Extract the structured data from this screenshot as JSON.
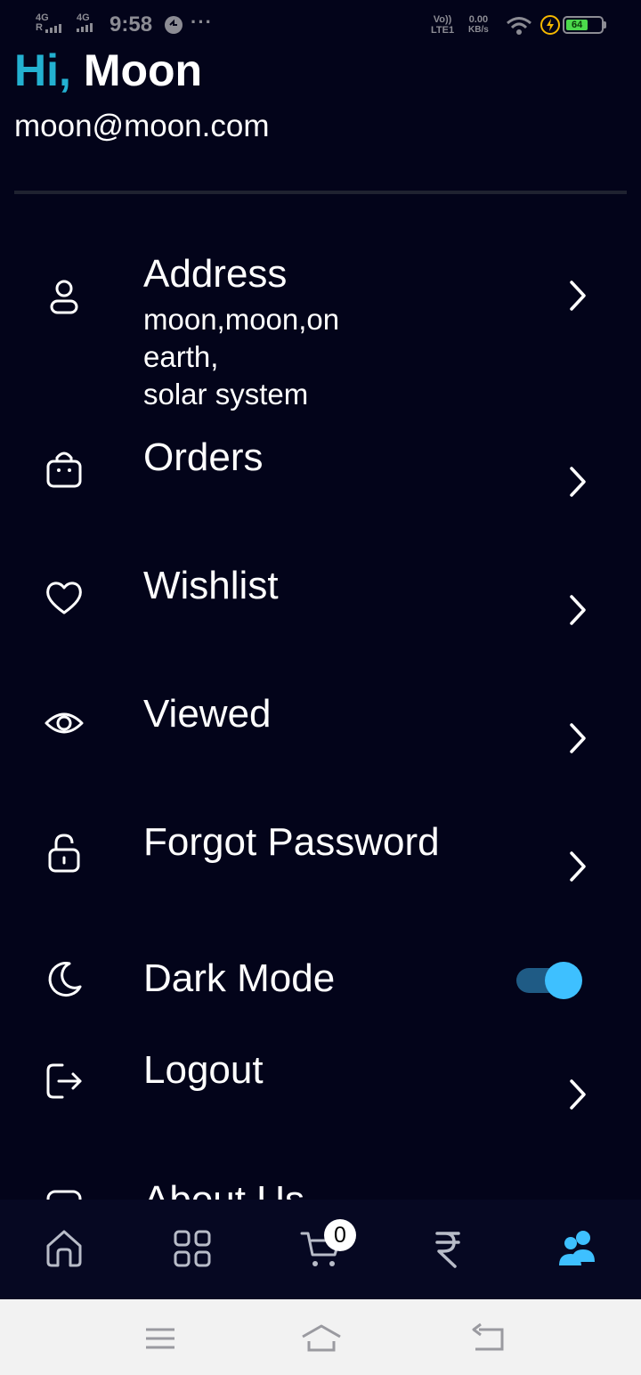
{
  "status_bar": {
    "network_1": "4G",
    "network_1_sub": "R",
    "network_2": "4G",
    "time": "9:58",
    "more": "···",
    "volte_top": "Vo))",
    "volte_bottom": "LTE1",
    "speed_value": "0.00",
    "speed_unit": "KB/s",
    "battery_level": "64",
    "battery_color": "#4cd94c",
    "charge_color": "#f5b800"
  },
  "header": {
    "greeting_prefix": "Hi,",
    "user_name": "Moon",
    "email": "moon@moon.com",
    "accent_color": "#23b1d1"
  },
  "menu": {
    "address": {
      "icon": "user-icon",
      "title": "Address",
      "subtitle": "moon,moon,on\nearth,\nsolar system"
    },
    "orders": {
      "icon": "shopping-bag-icon",
      "title": "Orders"
    },
    "wishlist": {
      "icon": "heart-icon",
      "title": "Wishlist"
    },
    "viewed": {
      "icon": "eye-icon",
      "title": "Viewed"
    },
    "forgot_password": {
      "icon": "unlock-icon",
      "title": "Forgot Password"
    },
    "dark_mode": {
      "icon": "moon-icon",
      "title": "Dark Mode",
      "enabled": true
    },
    "logout": {
      "icon": "logout-icon",
      "title": "Logout"
    },
    "about_us": {
      "icon": "info-icon",
      "title": "About Us"
    }
  },
  "bottom_nav": {
    "items": [
      {
        "name": "home",
        "icon": "home-icon",
        "active": false
      },
      {
        "name": "categories",
        "icon": "grid-icon",
        "active": false
      },
      {
        "name": "cart",
        "icon": "cart-icon",
        "active": false,
        "badge": "0"
      },
      {
        "name": "payments",
        "icon": "rupee-icon",
        "active": false
      },
      {
        "name": "account",
        "icon": "users-icon",
        "active": true
      }
    ],
    "active_color": "#3ec0ff"
  },
  "system_nav": {
    "buttons": [
      "menu-icon",
      "home-icon",
      "back-icon"
    ]
  }
}
